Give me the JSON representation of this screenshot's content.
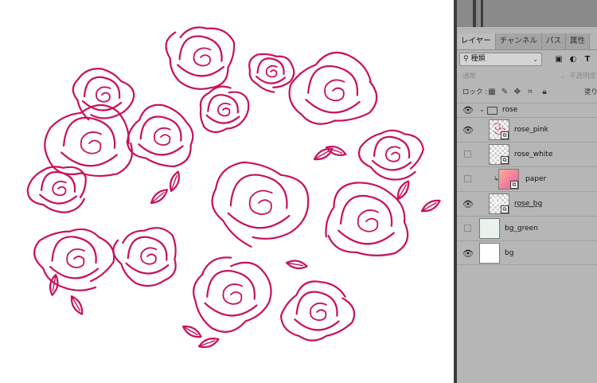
{
  "panel": {
    "tabs": [
      {
        "label": "レイヤー",
        "active": true
      },
      {
        "label": "チャンネル",
        "active": false
      },
      {
        "label": "パス",
        "active": false
      },
      {
        "label": "属性",
        "active": false
      }
    ],
    "filter": {
      "kind_value": "種類",
      "icons": [
        "image-filter-icon",
        "adjustment-filter-icon",
        "type-filter-icon"
      ]
    },
    "blend_mode": "通常",
    "opacity_label": "不透明度",
    "lock_label": "ロック :",
    "lock_icons": [
      "lock-transparent-icon",
      "lock-paint-icon",
      "lock-move-icon",
      "lock-artboard-icon",
      "lock-all-icon"
    ],
    "fill_label": "塗り"
  },
  "layers": [
    {
      "name": "rose",
      "type": "group",
      "visible": true,
      "expanded": true
    },
    {
      "name": "rose_pink",
      "type": "smart-object",
      "visible": true,
      "thumb": "pink-sketch"
    },
    {
      "name": "rose_white",
      "type": "smart-object",
      "visible": false,
      "thumb": "transparent"
    },
    {
      "name": "paper",
      "type": "clipped",
      "visible": false,
      "thumb": "pink-paper"
    },
    {
      "name": "rose_bg",
      "type": "smart-object",
      "visible": true,
      "thumb": "white-sketch"
    },
    {
      "name": "bg_green",
      "type": "fill",
      "visible": false,
      "thumb": "pale-green"
    },
    {
      "name": "bg",
      "type": "fill",
      "visible": true,
      "thumb": "white"
    }
  ],
  "colors": {
    "rose_line": "#c8105c",
    "panel_bg": "#b6b6b6",
    "tab_active": "#bdbdbd",
    "tab_inactive": "#a4a4a4",
    "bg_green": "#eaf2ec",
    "paper_pink": "#f39ab3"
  }
}
